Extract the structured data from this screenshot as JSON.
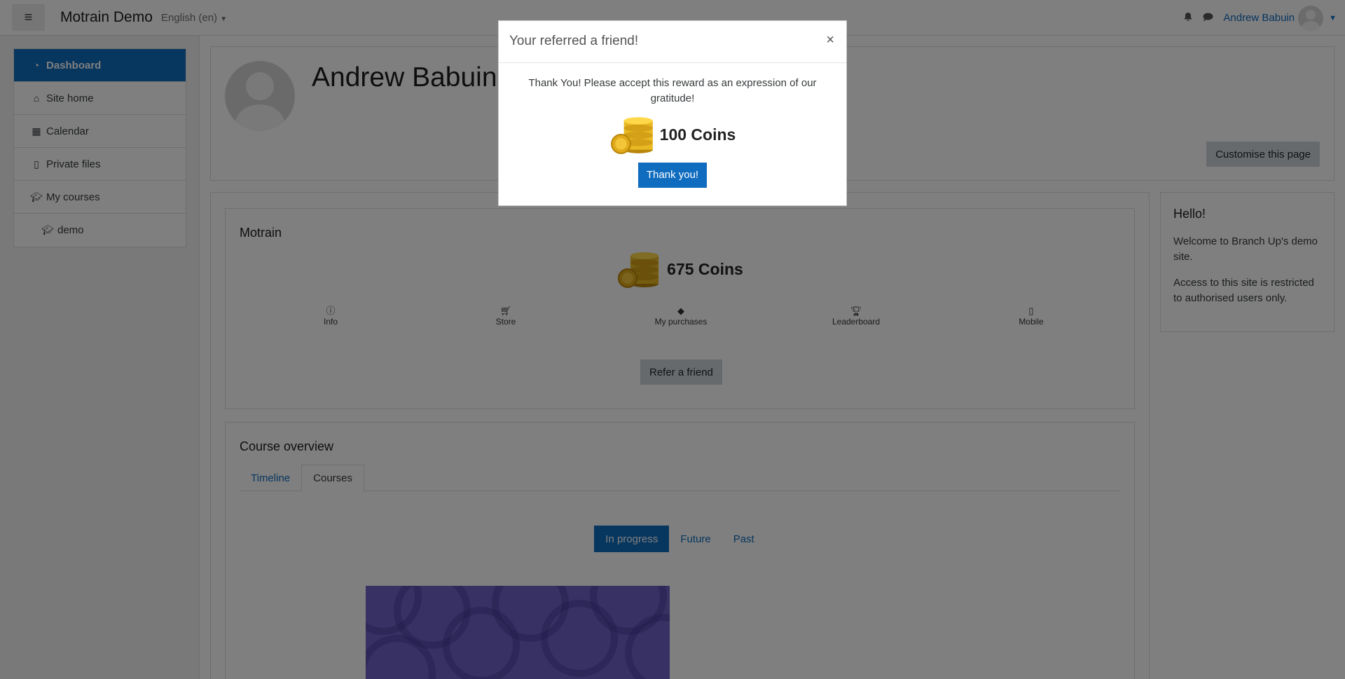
{
  "navbar": {
    "brand": "Motrain Demo",
    "language": "English (en)",
    "user_name": "Andrew Babuin",
    "icons": [
      "hamburger-icon",
      "bell-icon",
      "chat-icon",
      "caret-down-icon"
    ]
  },
  "sidebar": {
    "items": [
      {
        "label": "Dashboard",
        "icon": "dashboard-icon",
        "active": true
      },
      {
        "label": "Site home",
        "icon": "home-icon"
      },
      {
        "label": "Calendar",
        "icon": "calendar-icon"
      },
      {
        "label": "Private files",
        "icon": "file-icon"
      },
      {
        "label": "My courses",
        "icon": "graduation-cap-icon"
      },
      {
        "label": "demo",
        "icon": "graduation-cap-icon"
      }
    ]
  },
  "header": {
    "title": "Andrew Babuin",
    "customise_label": "Customise this page"
  },
  "motrain": {
    "title": "Motrain",
    "coins": "675 Coins",
    "nav": [
      {
        "label": "Info",
        "icon": "info-icon"
      },
      {
        "label": "Store",
        "icon": "cart-icon"
      },
      {
        "label": "My purchases",
        "icon": "tag-icon"
      },
      {
        "label": "Leaderboard",
        "icon": "trophy-icon"
      },
      {
        "label": "Mobile",
        "icon": "mobile-icon"
      }
    ],
    "refer_label": "Refer a friend"
  },
  "course_overview": {
    "title": "Course overview",
    "tabs": [
      {
        "label": "Timeline",
        "active": false
      },
      {
        "label": "Courses",
        "active": true
      }
    ],
    "filters": [
      {
        "label": "In progress",
        "active": true
      },
      {
        "label": "Future",
        "active": false
      },
      {
        "label": "Past",
        "active": false
      }
    ]
  },
  "hello_block": {
    "title": "Hello!",
    "p1": "Welcome to Branch Up's demo site.",
    "p2": "Access to this site is restricted to authorised users only."
  },
  "modal": {
    "title": "Your referred a friend!",
    "close": "×",
    "message": "Thank You! Please accept this reward as an expression of our gratitude!",
    "reward": "100 Coins",
    "button": "Thank you!"
  },
  "colors": {
    "accent": "#0f6cbf",
    "backdrop": "rgba(0,0,0,0.5)"
  }
}
